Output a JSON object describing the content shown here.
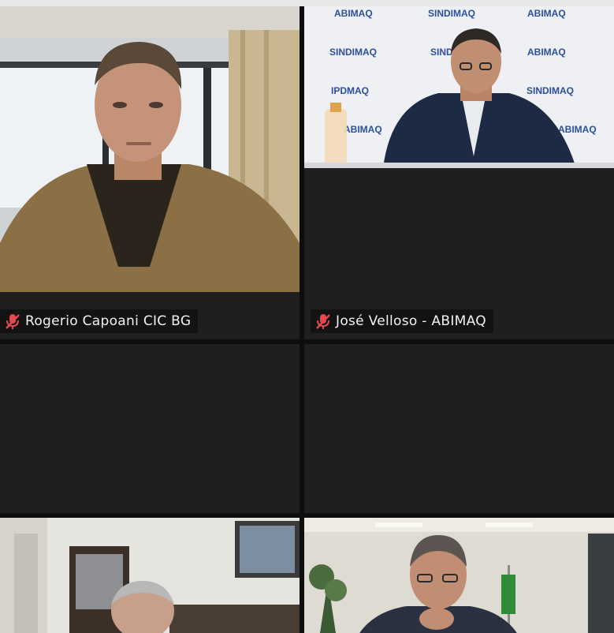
{
  "meeting": {
    "tiles": [
      {
        "name": "Rogerio Capoani CIC BG",
        "muted": true,
        "mic_icon": "mic-off-icon",
        "video": "webcam-feed"
      },
      {
        "name": "José Velloso - ABIMAQ",
        "muted": true,
        "mic_icon": "mic-off-icon",
        "video": "webcam-feed",
        "backdrop_logos": [
          "ABIMAQ",
          "SINDIMAQ",
          "ABIMAQ",
          "SINDIMAQ",
          "SINDIMAQ",
          "ABIMAQ",
          "IPDMAQ",
          "SINDIMAQ",
          "ABIMAQ",
          "ABIMAQ"
        ]
      },
      {
        "name": "",
        "video": "empty-tile"
      },
      {
        "name": "",
        "video": "empty-tile"
      },
      {
        "name": "",
        "video": "webcam-feed"
      },
      {
        "name": "",
        "video": "webcam-feed"
      }
    ],
    "colors": {
      "tile_bg": "#1f1f1f",
      "grid_gap": "#0e0e0e",
      "mute_red": "#e5484d",
      "label_bg": "#121212",
      "label_text": "#f2f2f2"
    }
  }
}
